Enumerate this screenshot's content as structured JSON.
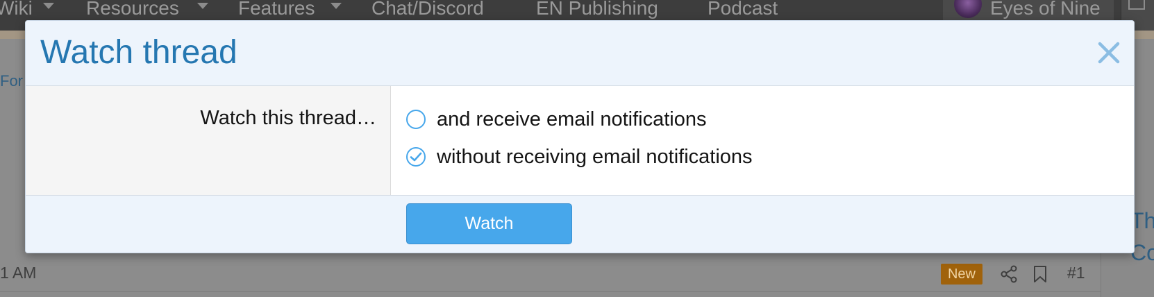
{
  "background": {
    "nav": [
      {
        "label": "Wiki",
        "has_caret": true
      },
      {
        "label": "Resources",
        "has_caret": true
      },
      {
        "label": "Features",
        "has_caret": true
      },
      {
        "label": "Chat/Discord",
        "has_caret": false
      },
      {
        "label": "EN Publishing",
        "has_caret": false
      },
      {
        "label": "Podcast",
        "has_caret": false
      }
    ],
    "username": "Eyes of Nine",
    "breadcrumb_fragment": "For",
    "post_time": "1 AM",
    "new_badge": "New",
    "post_number": "#1",
    "side_text_1": "Th",
    "side_text_2": "Co"
  },
  "modal": {
    "title": "Watch thread",
    "field_label": "Watch this thread…",
    "options": [
      {
        "label": "and receive email notifications",
        "checked": false
      },
      {
        "label": "without receiving email notifications",
        "checked": true
      }
    ],
    "submit_label": "Watch"
  },
  "colors": {
    "accent": "#47a7eb",
    "title": "#2577b1",
    "header_bg": "#edf4fc",
    "badge_new": "#a0620b"
  }
}
